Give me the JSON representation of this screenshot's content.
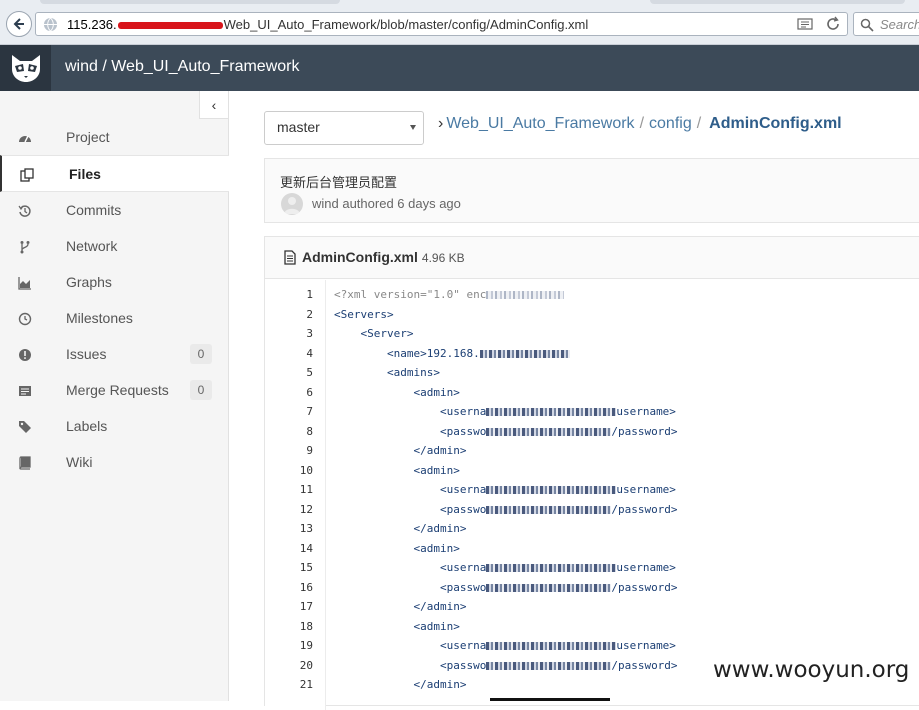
{
  "browser": {
    "url_host": "115.236.",
    "url_path": "Web_UI_Auto_Framework/blob/master/config/AdminConfig.xml",
    "search_placeholder": "Search"
  },
  "header": {
    "title": "wind / Web_UI_Auto_Framework"
  },
  "sidebar": {
    "collapse_glyph": "‹",
    "items": [
      {
        "label": "Project",
        "icon": "dashboard-icon"
      },
      {
        "label": "Files",
        "icon": "files-icon",
        "active": true
      },
      {
        "label": "Commits",
        "icon": "history-icon"
      },
      {
        "label": "Network",
        "icon": "code-fork-icon"
      },
      {
        "label": "Graphs",
        "icon": "area-chart-icon"
      },
      {
        "label": "Milestones",
        "icon": "clock-icon"
      },
      {
        "label": "Issues",
        "icon": "exclamation-circle-icon",
        "count": "0"
      },
      {
        "label": "Merge Requests",
        "icon": "list-alt-icon",
        "count": "0"
      },
      {
        "label": "Labels",
        "icon": "tags-icon"
      },
      {
        "label": "Wiki",
        "icon": "book-icon"
      }
    ]
  },
  "repo": {
    "branch": "master",
    "breadcrumbs": [
      "Web_UI_Auto_Framework",
      "config",
      "AdminConfig.xml"
    ]
  },
  "commit": {
    "message": "更新后台管理员配置",
    "meta": "wind authored 6 days ago"
  },
  "file": {
    "name": "AdminConfig.xml",
    "size": "4.96 KB",
    "lines": [
      {
        "n": "1",
        "text": "<?xml version=\"1.0\" enc"
      },
      {
        "n": "2",
        "text": "<Servers>"
      },
      {
        "n": "3",
        "text": "    <Server>"
      },
      {
        "n": "4",
        "text": "        <name>192.168."
      },
      {
        "n": "5",
        "text": "        <admins>"
      },
      {
        "n": "6",
        "text": "            <admin>"
      },
      {
        "n": "7",
        "text": "                <userna",
        "tail": "username>"
      },
      {
        "n": "8",
        "text": "                <passwo",
        "tail": "/password>"
      },
      {
        "n": "9",
        "text": "            </admin>"
      },
      {
        "n": "10",
        "text": "            <admin>"
      },
      {
        "n": "11",
        "text": "                <userna",
        "tail": "username>"
      },
      {
        "n": "12",
        "text": "                <passwo",
        "tail": "/password>"
      },
      {
        "n": "13",
        "text": "            </admin>"
      },
      {
        "n": "14",
        "text": "            <admin>"
      },
      {
        "n": "15",
        "text": "                <userna",
        "tail": "username>"
      },
      {
        "n": "16",
        "text": "                <passwo",
        "tail": "/password>"
      },
      {
        "n": "17",
        "text": "            </admin>"
      },
      {
        "n": "18",
        "text": "            <admin>"
      },
      {
        "n": "19",
        "text": "                <userna",
        "tail": "username>"
      },
      {
        "n": "20",
        "text": "                <passwo",
        "tail": "/password>"
      },
      {
        "n": "21",
        "text": "            </admin>"
      }
    ]
  },
  "watermark": "www.wooyun.org"
}
